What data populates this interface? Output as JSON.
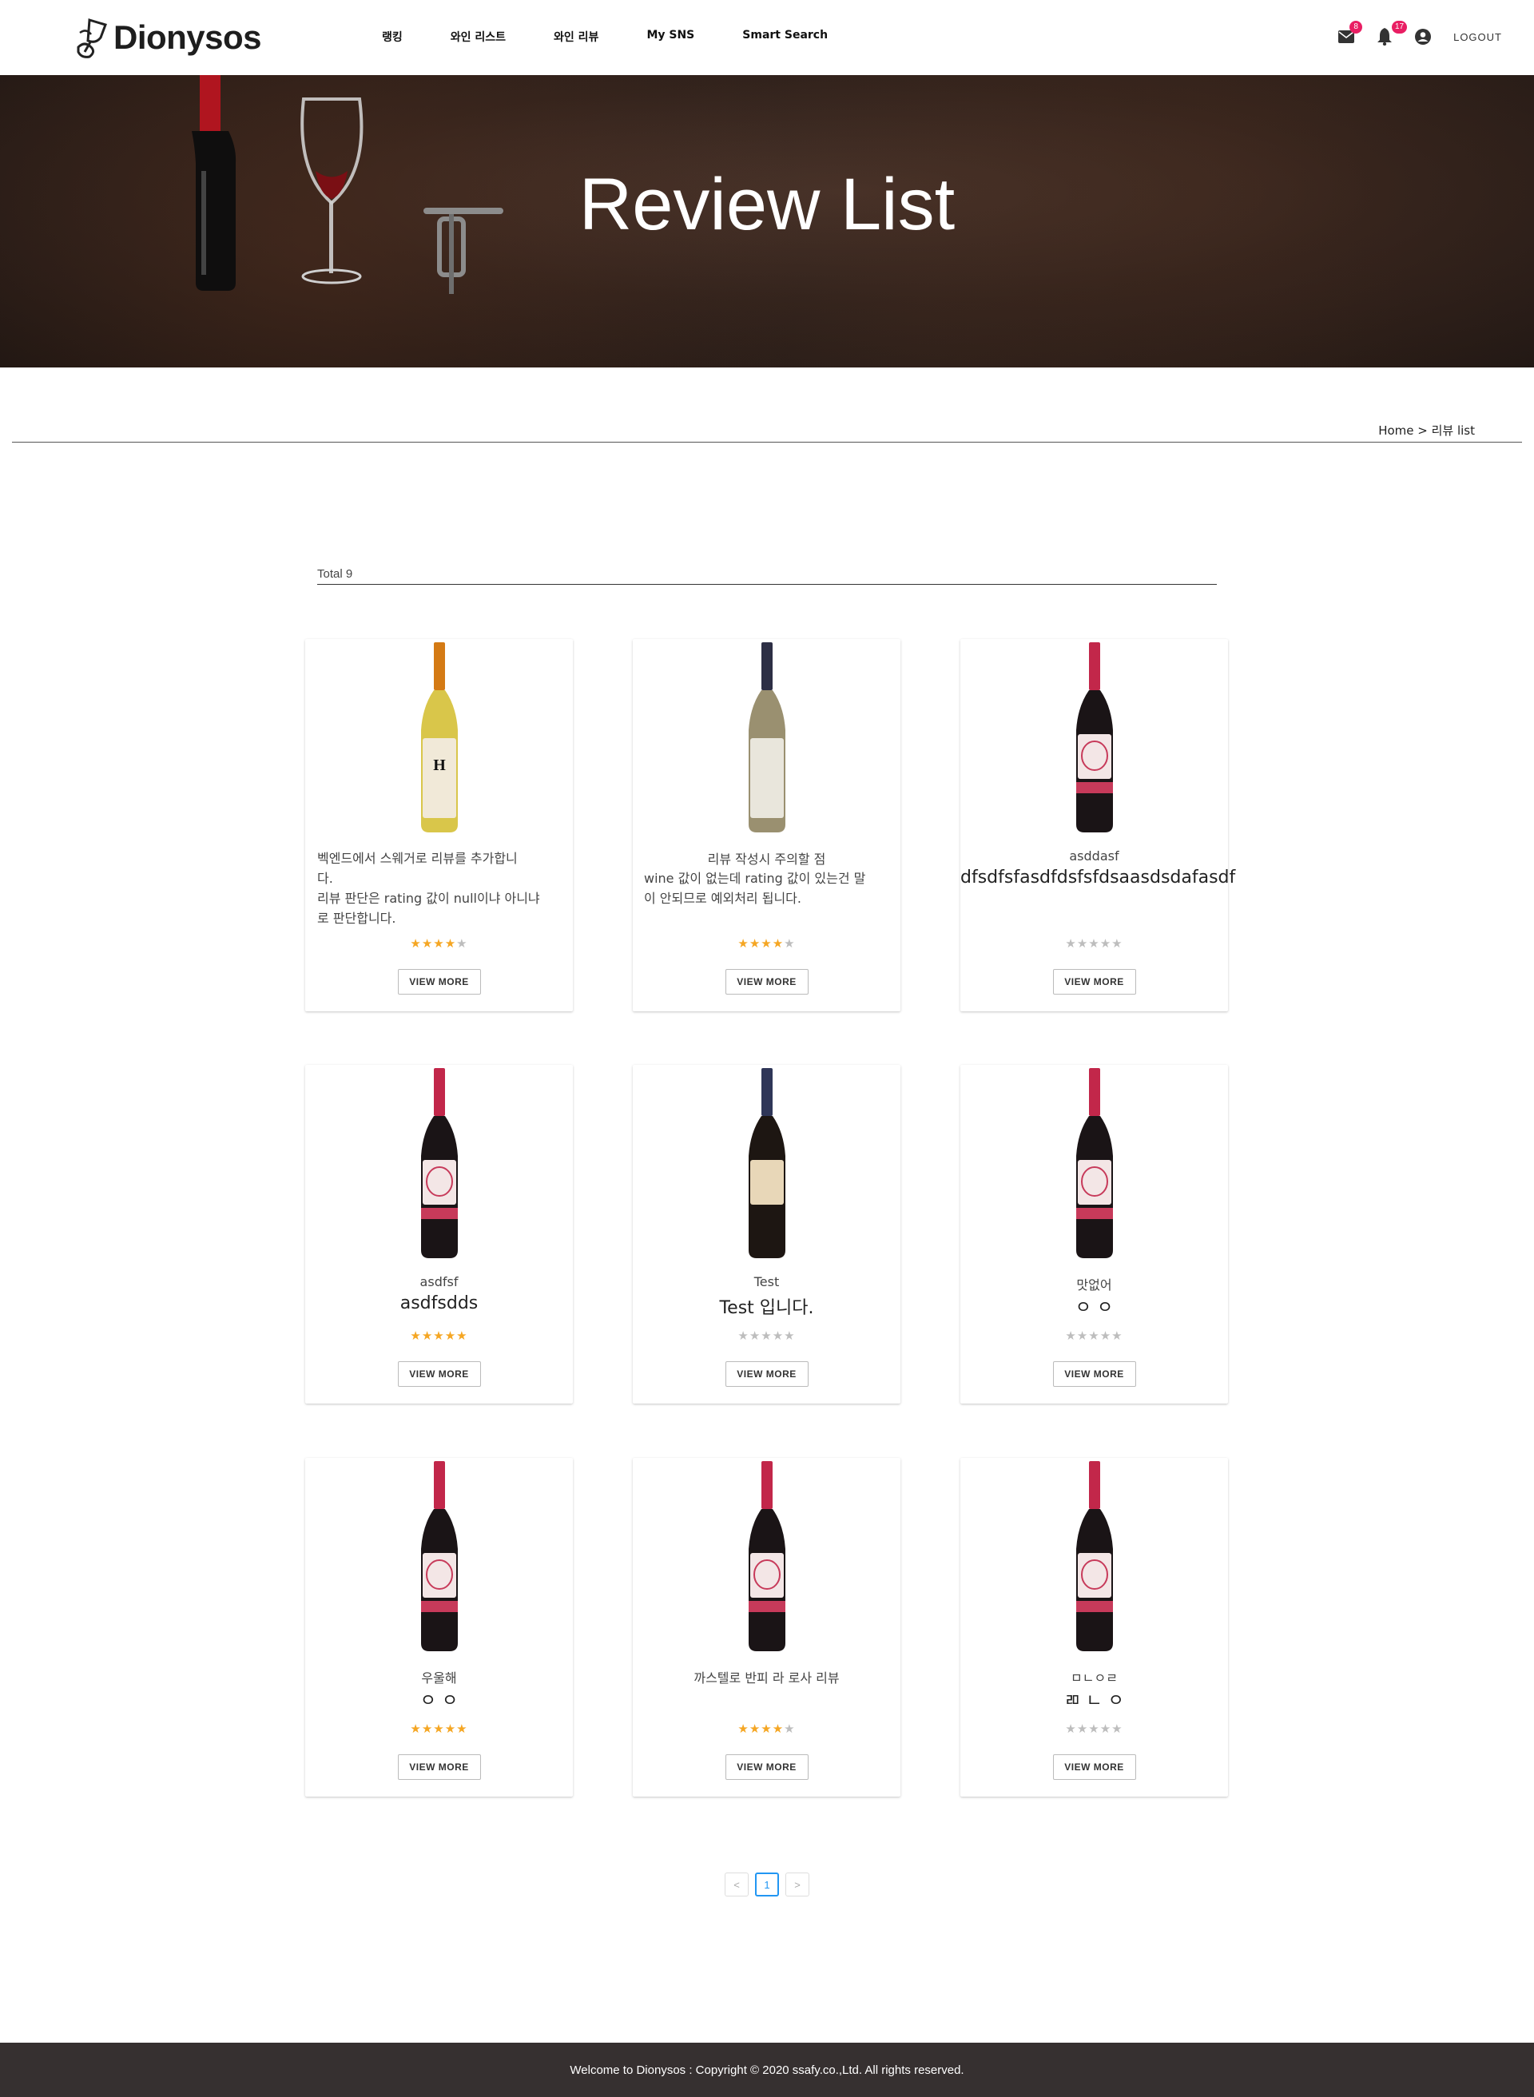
{
  "brand": {
    "name": "Dionysos"
  },
  "nav": {
    "items": [
      "랭킹",
      "와인 리스트",
      "와인 리뷰",
      "My SNS",
      "Smart Search"
    ],
    "mail_badge": "8",
    "notification_badge": "17",
    "logout_label": "LOGOUT"
  },
  "hero": {
    "title": "Review List"
  },
  "breadcrumb": "Home > 리뷰 list",
  "total_label": "Total 9",
  "cards": [
    {
      "title": "",
      "body": [
        "벡엔드에서 스웨거로 리뷰를 추가합니",
        "다.",
        "리뷰 판단은 rating 값이 null이냐 아니냐",
        "로 판단합니다."
      ],
      "content": "",
      "rating": 4,
      "bottle": "white-yellow",
      "button": "VIEW MORE"
    },
    {
      "title": "리뷰 작성시 주의할 점",
      "body": [
        "wine 값이 없는데 rating 값이 있는건 말",
        "이 안되므로 예외처리 됩니다."
      ],
      "content": "",
      "rating": 4,
      "bottle": "white-label",
      "button": "VIEW MORE"
    },
    {
      "title": "asddasf",
      "body": [],
      "content": "dfsdfsfasdfdsfsfdsaasdsdafasdf",
      "rating": 0,
      "bottle": "red",
      "button": "VIEW MORE"
    },
    {
      "title": "asdfsf",
      "body": [],
      "content": "asdfsdds",
      "rating": 5,
      "bottle": "red",
      "button": "VIEW MORE"
    },
    {
      "title": "Test",
      "body": [],
      "content": "Test 입니다.",
      "rating": 0,
      "bottle": "red-beige",
      "button": "VIEW MORE"
    },
    {
      "title": "맛없어",
      "body": [],
      "content": "ㅇ ㅇ",
      "rating": 0,
      "bottle": "red",
      "button": "VIEW MORE"
    },
    {
      "title": "우울해",
      "body": [],
      "content": "ㅇ ㅇ",
      "rating": 5,
      "bottle": "red",
      "button": "VIEW MORE"
    },
    {
      "title": "까스텔로 반피 라 로사 리뷰",
      "body": [],
      "content": "",
      "rating": 4,
      "bottle": "red",
      "button": "VIEW MORE"
    },
    {
      "title": "ㅁㄴㅇㄹ",
      "body": [],
      "content": "ㄻ ㄴ ㅇ",
      "rating": 0,
      "bottle": "red",
      "button": "VIEW MORE"
    }
  ],
  "pagination": {
    "prev": "<",
    "current": "1",
    "next": ">"
  },
  "footer": "Welcome to Dionysos : Copyright © 2020 ssafy.co.,Ltd. All rights reserved.",
  "colors": {
    "accent": "#e91e63",
    "star": "#f5a623",
    "footer_bg": "#363030",
    "page_active": "#2196f3"
  }
}
